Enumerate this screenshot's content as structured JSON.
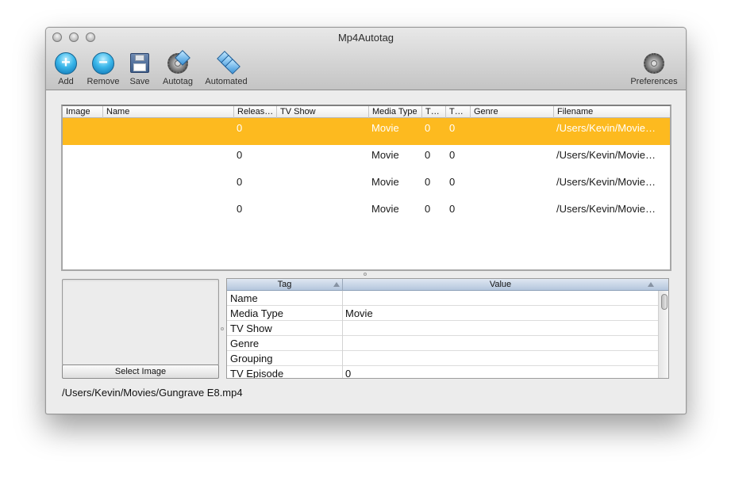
{
  "window": {
    "title": "Mp4Autotag"
  },
  "toolbar": {
    "add": "Add",
    "remove": "Remove",
    "save": "Save",
    "autotag": "Autotag",
    "automated": "Automated",
    "preferences": "Preferences"
  },
  "files_table": {
    "columns": [
      "Image",
      "Name",
      "Releas…",
      "TV Show",
      "Media Type",
      "T…",
      "T…",
      "Genre",
      "Filename"
    ],
    "rows": [
      {
        "image": "",
        "name": "",
        "release": "0",
        "tv_show": "",
        "media_type": "Movie",
        "t1": "0",
        "t2": "0",
        "genre": "",
        "filename": "/Users/Kevin/Movie…",
        "selected": true
      },
      {
        "image": "",
        "name": "",
        "release": "0",
        "tv_show": "",
        "media_type": "Movie",
        "t1": "0",
        "t2": "0",
        "genre": "",
        "filename": "/Users/Kevin/Movie…",
        "selected": false
      },
      {
        "image": "",
        "name": "",
        "release": "0",
        "tv_show": "",
        "media_type": "Movie",
        "t1": "0",
        "t2": "0",
        "genre": "",
        "filename": "/Users/Kevin/Movie…",
        "selected": false
      },
      {
        "image": "",
        "name": "",
        "release": "0",
        "tv_show": "",
        "media_type": "Movie",
        "t1": "0",
        "t2": "0",
        "genre": "",
        "filename": "/Users/Kevin/Movie…",
        "selected": false
      }
    ],
    "selected_color": "#fdba1f"
  },
  "artwork": {
    "select_image_label": "Select Image"
  },
  "tag_table": {
    "headers": {
      "tag": "Tag",
      "value": "Value"
    },
    "rows": [
      {
        "tag": "Name",
        "value": ""
      },
      {
        "tag": "Media Type",
        "value": "Movie"
      },
      {
        "tag": "TV Show",
        "value": ""
      },
      {
        "tag": "Genre",
        "value": ""
      },
      {
        "tag": "Grouping",
        "value": ""
      },
      {
        "tag": "TV Episode",
        "value": "0"
      }
    ]
  },
  "status": {
    "path": "/Users/Kevin/Movies/Gungrave E8.mp4"
  }
}
